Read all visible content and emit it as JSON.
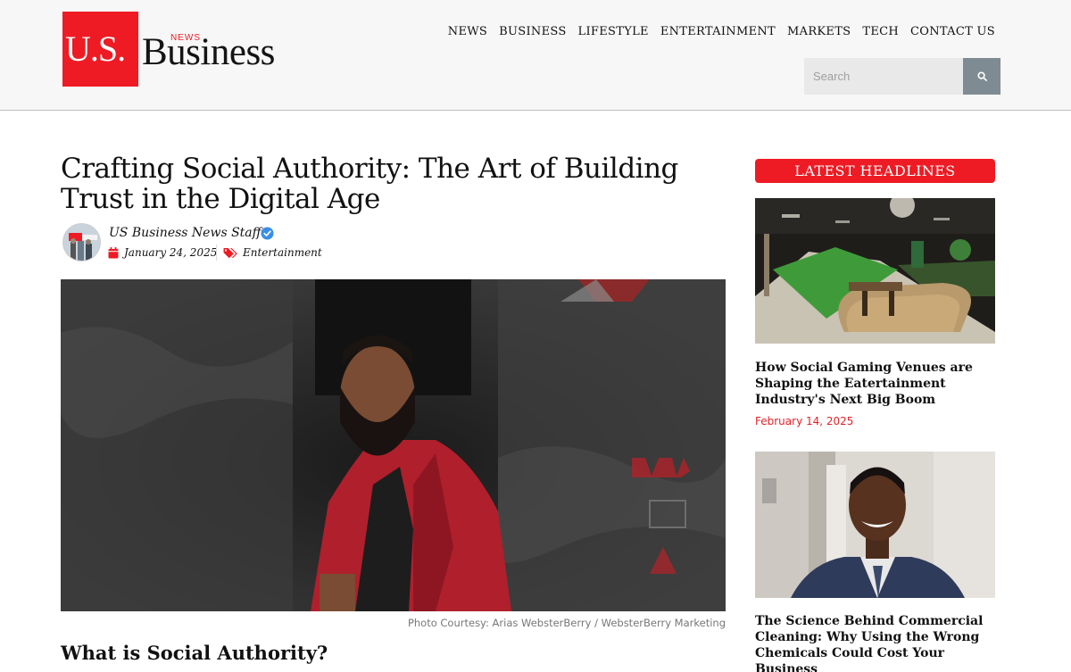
{
  "logo": {
    "us": "U.S.",
    "news": "NEWS",
    "business": "Business"
  },
  "nav": [
    "NEWS",
    "BUSINESS",
    "LIFESTYLE",
    "ENTERTAINMENT",
    "MARKETS",
    "TECH",
    "CONTACT US"
  ],
  "search": {
    "placeholder": "Search"
  },
  "article": {
    "title": "Crafting Social Authority: The Art of Building Trust in the Digital Age",
    "author": "US Business News Staff",
    "date": "January 24, 2025",
    "category": "Entertainment",
    "caption": "Photo Courtesy: Arias WebsterBerry / WebsterBerry Marketing",
    "subhead": "What is Social Authority?"
  },
  "sidebar": {
    "heading": "LATEST HEADLINES",
    "items": [
      {
        "title": "How Social Gaming Venues are Shaping the Eatertainment Industry's Next Big Boom",
        "date": "February 14, 2025"
      },
      {
        "title": "The Science Behind Commercial Cleaning: Why Using the Wrong Chemicals Could Cost Your Business"
      }
    ]
  },
  "colors": {
    "brand_red": "#ee1b24",
    "date_red": "#e3232a",
    "search_button": "#7f8b93"
  }
}
